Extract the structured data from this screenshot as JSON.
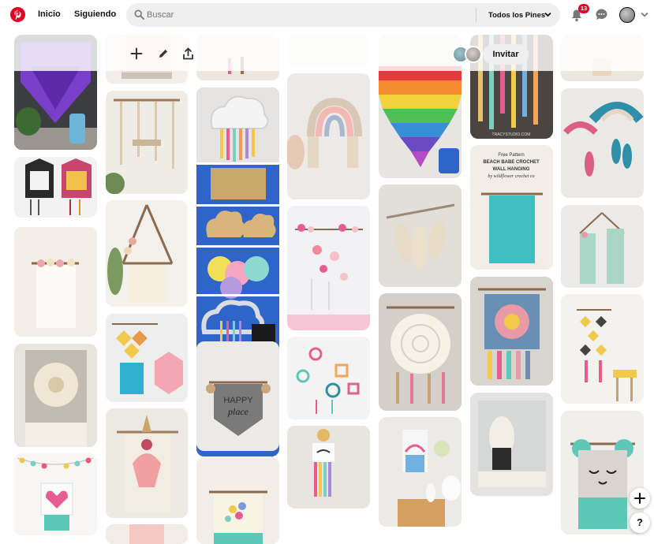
{
  "header": {
    "nav_home": "Inicio",
    "nav_following": "Siguiendo",
    "search_placeholder": "Buscar",
    "search_scope": "Todos los Pines",
    "notification_count": "13",
    "accent_color": "#e60023"
  },
  "board_toolbar": {
    "invite_label": "Invitar",
    "icons": [
      "add-icon",
      "edit-icon",
      "share-icon"
    ]
  },
  "pins": [
    {
      "alt": "Purple macrame heart wall hanging with vase"
    },
    {
      "alt": "Geometric crochet wall hangings"
    },
    {
      "alt": "White flower fringe wall hanging"
    },
    {
      "alt": "Round woven wall hanging"
    },
    {
      "alt": "Heart bead garland wall hanging"
    },
    {
      "alt": "Small macrame wall hanging"
    },
    {
      "alt": "Hanging macrame shelf"
    },
    {
      "alt": "Tripod flower wall hanging"
    },
    {
      "alt": "Diamond crochet wall hanging"
    },
    {
      "alt": "Pink tassel doll wall hanging"
    },
    {
      "alt": "Pink hanging"
    },
    {
      "alt": "Rainbow cloud yarn wall hanging tutorial"
    },
    {
      "alt": "Happy place crochet wall hanging",
      "text": "HAPPY place"
    },
    {
      "alt": "Floral cross stitch wall hanging"
    },
    {
      "alt": "White wall hanging"
    },
    {
      "alt": "Rainbow tassel wall hanging"
    },
    {
      "alt": "Flower garland wall hanging"
    },
    {
      "alt": "Mandala tassel wall hanging"
    },
    {
      "alt": "Eyelash rainbow wall hanging"
    },
    {
      "alt": "Rainbow pom pom wall hanging"
    },
    {
      "alt": "Macrame feather leaves"
    },
    {
      "alt": "Crochet mandala doily wall hanging"
    },
    {
      "alt": "Rainbow kids room wall hanging"
    },
    {
      "alt": "Painted driftwood sticks",
      "text": "TRACYSTUDIO.COM"
    },
    {
      "alt": "Free pattern crochet wall hanging",
      "text": "Free Pattern BEACH BABE CROCHET WALL HANGING by wildflower crochet co"
    },
    {
      "alt": "Granny square tassel wall hanging"
    },
    {
      "alt": "Girl with curls woven wall hanging"
    },
    {
      "alt": "Beige tassel hanging"
    },
    {
      "alt": "Blue crochet rainbow with feathers"
    },
    {
      "alt": "Mint woven wall hangings"
    },
    {
      "alt": "Diamond tassel mobile"
    },
    {
      "alt": "Bear face woven wall hanging"
    }
  ],
  "floating": {
    "help_label": "?"
  }
}
